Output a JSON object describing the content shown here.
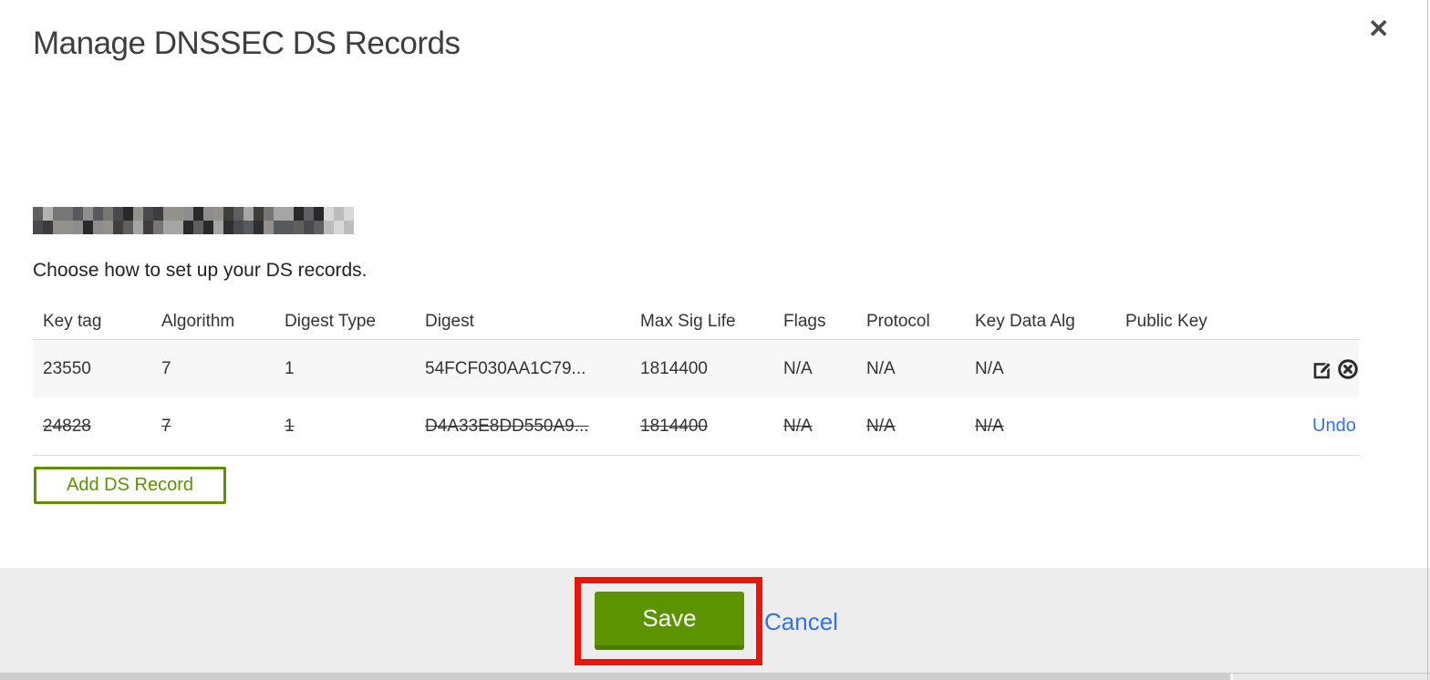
{
  "modal": {
    "title": "Manage DNSSEC DS Records",
    "close_icon": "✕",
    "instruction": "Choose how to set up your DS records.",
    "table": {
      "columns": [
        "Key tag",
        "Algorithm",
        "Digest Type",
        "Digest",
        "Max Sig Life",
        "Flags",
        "Protocol",
        "Key Data Alg",
        "Public Key"
      ],
      "rows": [
        {
          "key_tag": "23550",
          "algorithm": "7",
          "digest_type": "1",
          "digest": "54FCF030AA1C79...",
          "max_sig_life": "1814400",
          "flags": "N/A",
          "protocol": "N/A",
          "key_data_alg": "N/A",
          "public_key": "",
          "state": "active"
        },
        {
          "key_tag": "24828",
          "algorithm": "7",
          "digest_type": "1",
          "digest": "D4A33E8DD550A9...",
          "max_sig_life": "1814400",
          "flags": "N/A",
          "protocol": "N/A",
          "key_data_alg": "N/A",
          "public_key": "",
          "state": "marked-for-deletion",
          "undo_label": "Undo"
        }
      ]
    },
    "add_button_label": "Add DS Record",
    "footer": {
      "save_label": "Save",
      "cancel_label": "Cancel"
    }
  },
  "colors": {
    "accent_green": "#5c9200",
    "save_button_green": "#5b9400",
    "save_button_shadow": "#4a7c05",
    "link_blue": "#2e73f2",
    "annotation_red": "#ec150b",
    "row_highlight_bg": "#f7f7f7",
    "footer_bg": "#ededed"
  }
}
